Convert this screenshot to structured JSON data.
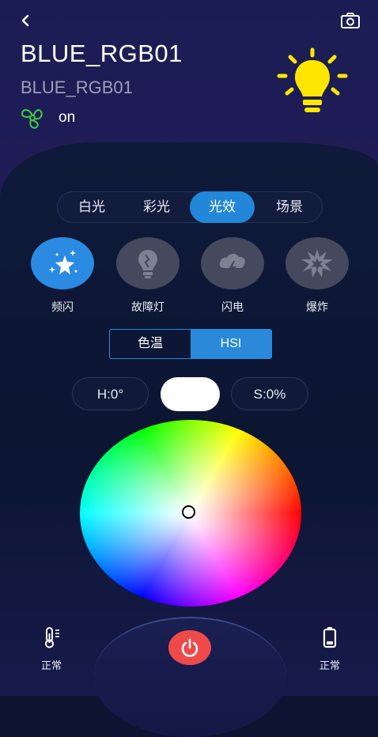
{
  "header": {
    "title": "BLUE_RGB01",
    "subtitle": "BLUE_RGB01",
    "status": "on"
  },
  "icons": {
    "back": "chevron-left-icon",
    "camera": "camera-icon",
    "fan": "fan-icon",
    "bulb": "light-bulb-icon",
    "thermometer": "thermometer-icon",
    "battery": "battery-icon",
    "power": "power-icon"
  },
  "tabs": [
    {
      "label": "白光",
      "active": false
    },
    {
      "label": "彩光",
      "active": false
    },
    {
      "label": "光效",
      "active": true
    },
    {
      "label": "场景",
      "active": false
    }
  ],
  "effects": [
    {
      "label": "频闪",
      "icon": "sparkle-star-icon",
      "active": true
    },
    {
      "label": "故障灯",
      "icon": "broken-bulb-icon",
      "active": false
    },
    {
      "label": "闪电",
      "icon": "storm-cloud-icon",
      "active": false
    },
    {
      "label": "爆炸",
      "icon": "explosion-icon",
      "active": false
    }
  ],
  "mode_toggle": {
    "options": [
      "色温",
      "HSI"
    ],
    "selected": "HSI"
  },
  "hsi": {
    "hue_label": "H:0°",
    "saturation_label": "S:0%",
    "preview_color": "#ffffff"
  },
  "footer": {
    "temperature_status": "正常",
    "battery_status": "正常"
  },
  "colors": {
    "accent": "#2287d8",
    "power": "#ee4a4a",
    "bulb": "#ffe600",
    "fan": "#3ccf3c"
  }
}
